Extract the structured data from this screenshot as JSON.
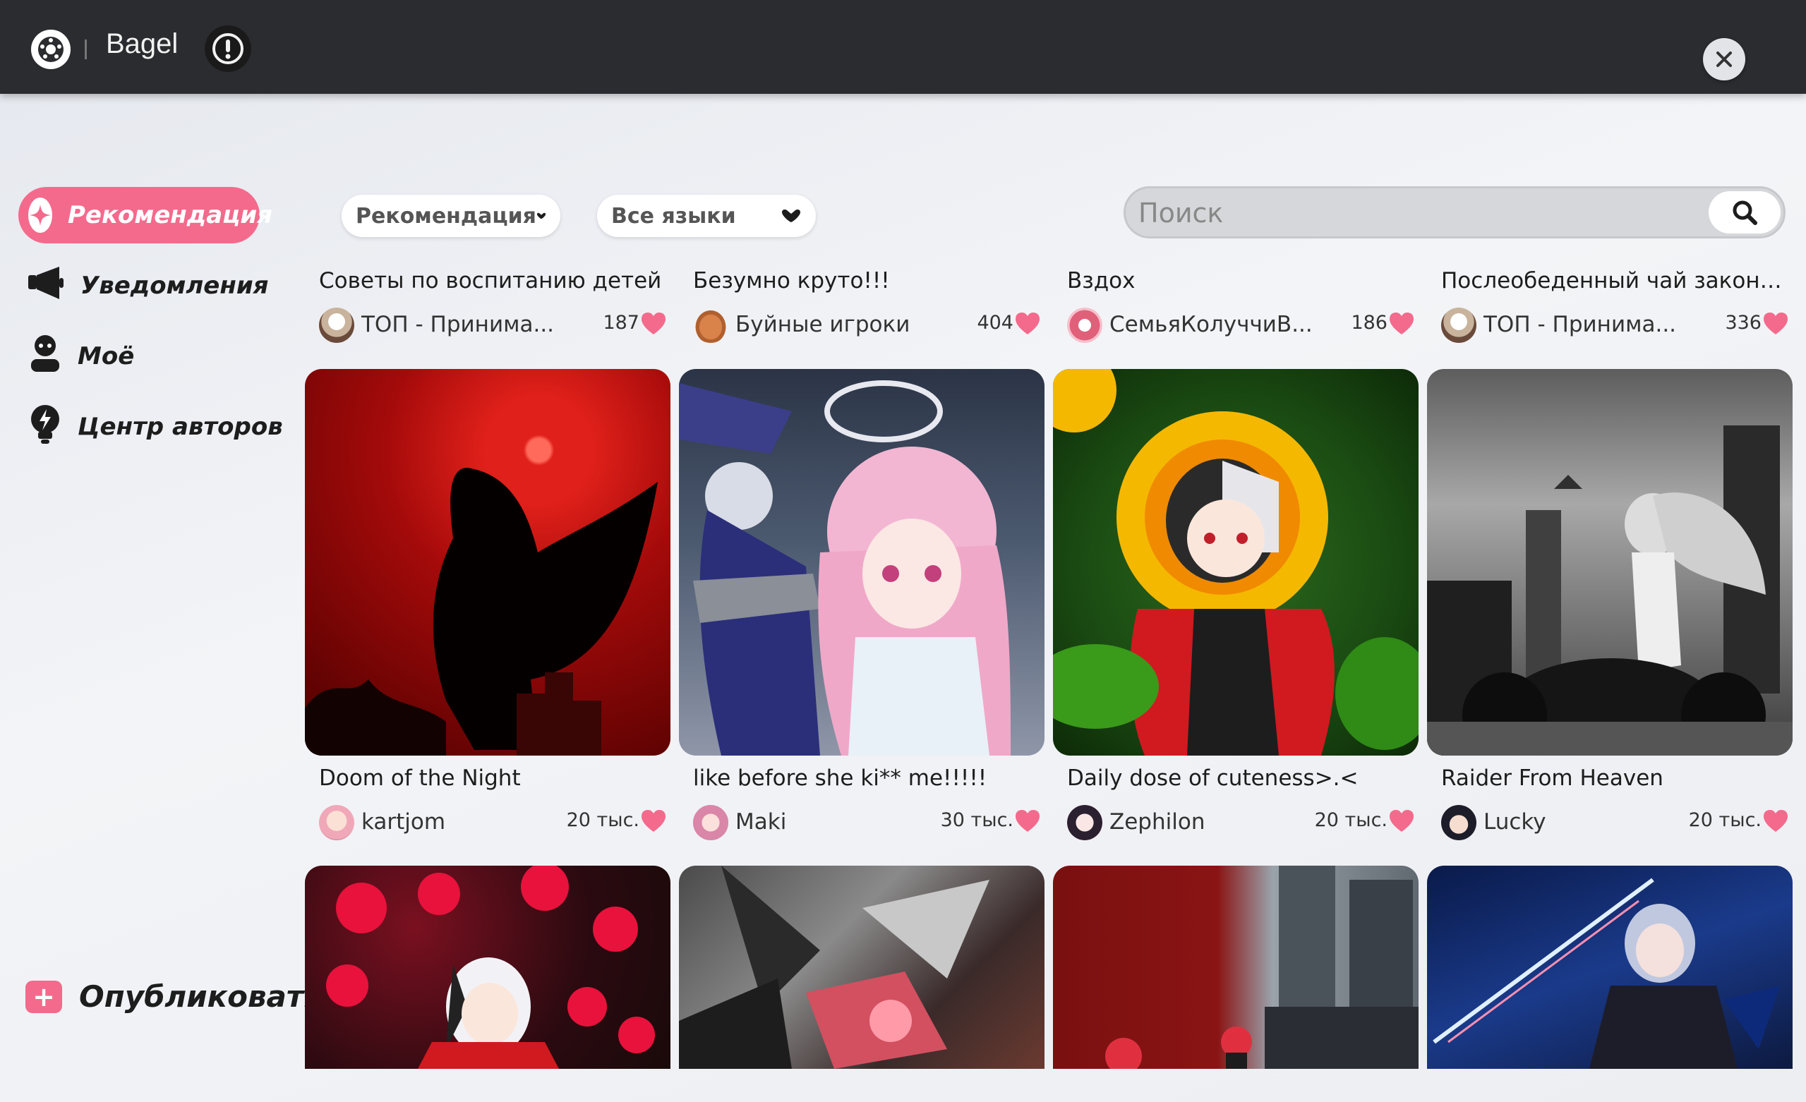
{
  "window": {
    "title": "Bagel"
  },
  "sidebar": {
    "items": [
      {
        "label": "Рекомендация",
        "active": true
      },
      {
        "label": "Уведомления"
      },
      {
        "label": "Моё"
      },
      {
        "label": "Центр авторов"
      }
    ],
    "publish_label": "Опубликовать"
  },
  "filters": {
    "sort": "Рекомендация",
    "language": "Все языки"
  },
  "search": {
    "placeholder": "Поиск"
  },
  "colors": {
    "accent": "#f46a8c",
    "topbar": "#2b2c2f"
  },
  "row1": [
    {
      "title": "Советы по воспитанию детей",
      "author": "ТОП - Принима...",
      "likes": "187"
    },
    {
      "title": "Безумно круто!!!",
      "author": "Буйные игроки",
      "likes": "404"
    },
    {
      "title": "Вздох",
      "author": "СемьяКолуччиВ...",
      "likes": "186"
    },
    {
      "title": "Послеобеденный чай закончи...",
      "author": "ТОП - Принима...",
      "likes": "336"
    }
  ],
  "row2": [
    {
      "title": "Doom of the Night",
      "author": "kartjom",
      "likes": "20 тыс."
    },
    {
      "title": "like before she ki** me!!!!!",
      "author": "Maki",
      "likes": "30 тыс."
    },
    {
      "title": "Daily dose of cuteness>.<",
      "author": "Zephilon",
      "likes": "20 тыс."
    },
    {
      "title": "Raider From Heaven",
      "author": "Lucky",
      "likes": "20 тыс."
    }
  ]
}
